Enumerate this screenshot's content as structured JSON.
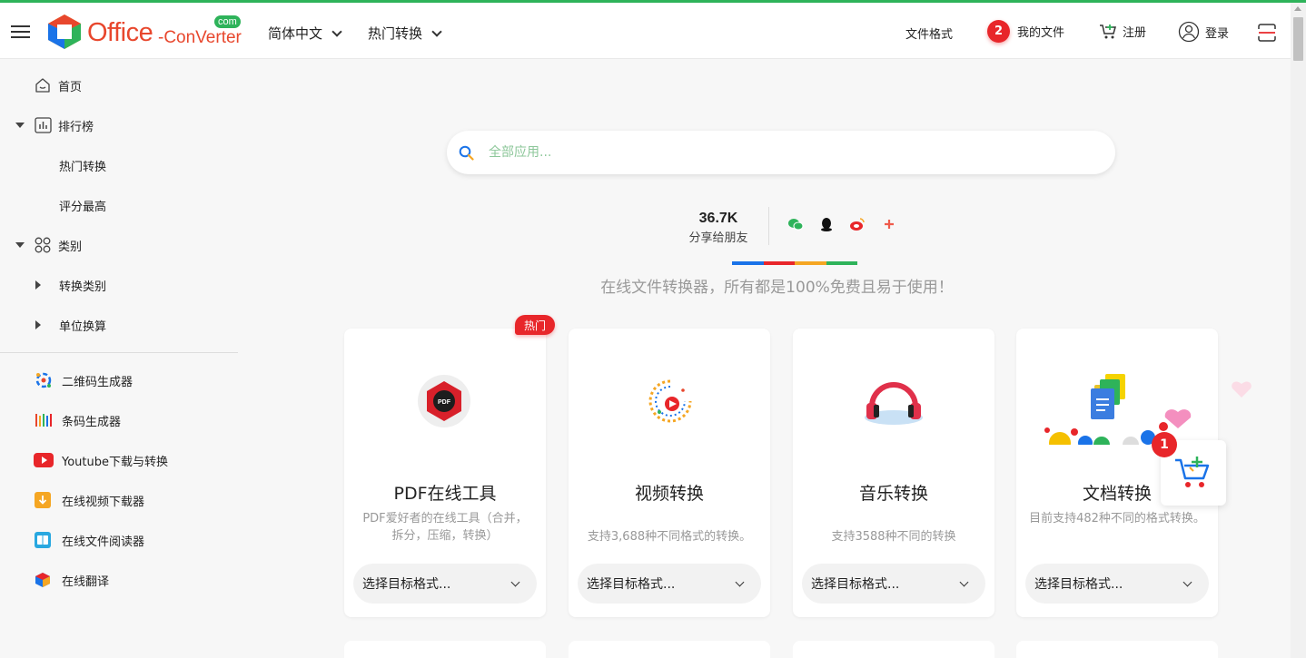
{
  "header": {
    "logo_office": "Office",
    "logo_converter": "-ConVerter",
    "logo_com": "com",
    "language_label": "简体中文",
    "hot_convert_label": "热门转换",
    "file_format_label": "文件格式",
    "my_files_badge": "2",
    "my_files_label": "我的文件",
    "register_label": "注册",
    "login_label": "登录"
  },
  "sidebar": {
    "items": [
      {
        "label": "首页"
      },
      {
        "label": "排行榜"
      },
      {
        "label": "热门转换"
      },
      {
        "label": "评分最高"
      },
      {
        "label": "类别"
      },
      {
        "label": "转换类别"
      },
      {
        "label": "单位换算"
      }
    ],
    "tools": [
      {
        "label": "二维码生成器"
      },
      {
        "label": "条码生成器"
      },
      {
        "label": "Youtube下载与转换"
      },
      {
        "label": "在线视频下载器"
      },
      {
        "label": "在线文件阅读器"
      },
      {
        "label": "在线翻译"
      }
    ]
  },
  "search": {
    "placeholder": "全部应用..."
  },
  "share": {
    "count": "36.7K",
    "label": "分享给朋友"
  },
  "colors": {
    "accent_green": "#2eb35a",
    "brand_red": "#e8472d",
    "badge_red": "#e8262a"
  },
  "tagline": "在线文件转换器，所有都是100%免费且易于使用！",
  "hot_tag": "热门",
  "cards": [
    {
      "title": "PDF在线工具",
      "desc": "PDF爱好者的在线工具（合并，拆分，压缩，转换）",
      "select": "选择目标格式..."
    },
    {
      "title": "视频转换",
      "desc": "支持3,688种不同格式的转换。",
      "select": "选择目标格式..."
    },
    {
      "title": "音乐转换",
      "desc": "支持3588种不同的转换",
      "select": "选择目标格式..."
    },
    {
      "title": "文档转换",
      "desc": "目前支持482种不同的格式转换。",
      "select": "选择目标格式..."
    }
  ],
  "cart": {
    "badge": "1"
  }
}
